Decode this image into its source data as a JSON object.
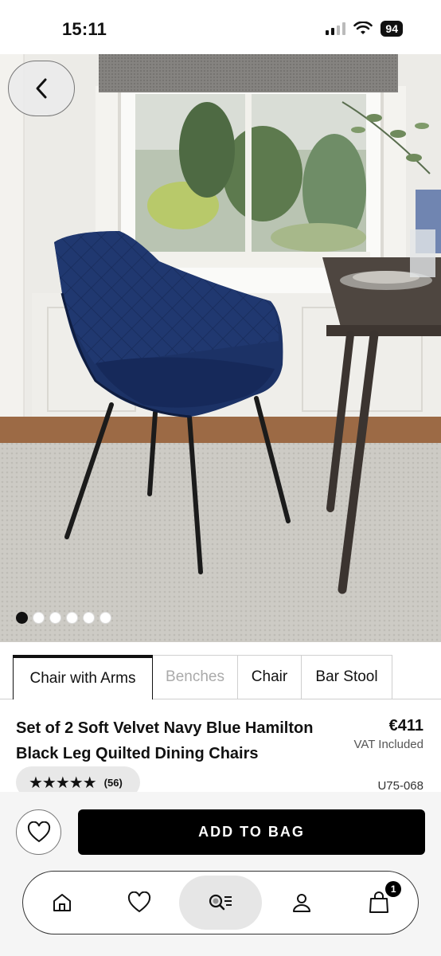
{
  "status_bar": {
    "time": "15:11",
    "battery": "94"
  },
  "hero": {
    "image_alt": "navy-velvet-chair-photo",
    "dots_total": 6,
    "dots_active_index": 0
  },
  "tabs": [
    {
      "label": "Chair with Arms",
      "state": "active"
    },
    {
      "label": "Benches",
      "state": "disabled"
    },
    {
      "label": "Chair",
      "state": "normal"
    },
    {
      "label": "Bar Stool",
      "state": "normal"
    }
  ],
  "product": {
    "title": "Set of 2 Soft Velvet Navy Blue Hamilton Black Leg Quilted Dining Chairs",
    "price": "€411",
    "vat_note": "VAT Included",
    "rating_stars": "★★★★★",
    "rating_value": 4.5,
    "review_count": "(56)",
    "sku": "U75-068"
  },
  "actions": {
    "add_to_bag_label": "ADD TO BAG"
  },
  "bottom_nav": {
    "items": [
      "home-icon",
      "heart-icon",
      "search-icon",
      "account-icon",
      "bag-icon"
    ],
    "active_index": 2,
    "bag_badge": "1"
  },
  "colors": {
    "accent": "#000000",
    "chair_navy": "#1c3266",
    "panel_bg": "#f5f5f5"
  }
}
